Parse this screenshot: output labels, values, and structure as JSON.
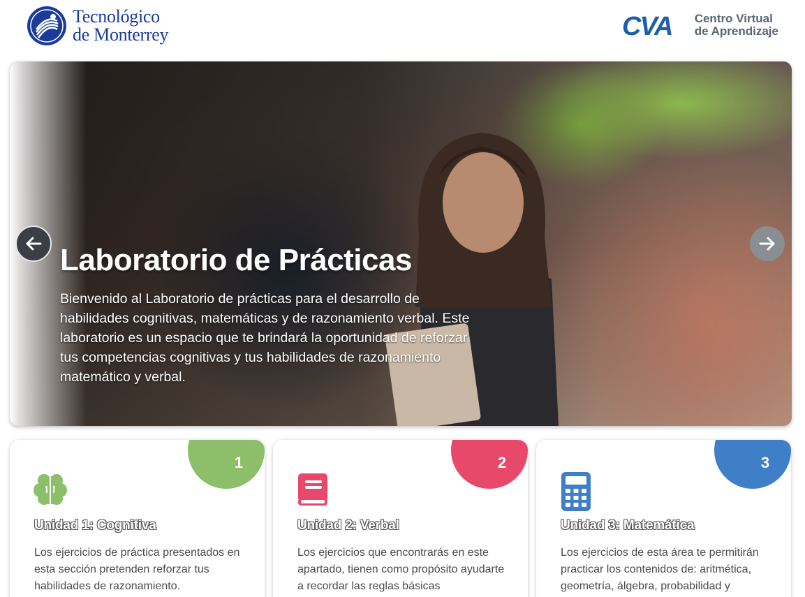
{
  "header": {
    "tec_logo": {
      "line1": "Tecnológico",
      "line2": "de Monterrey"
    },
    "cva_logo": {
      "mark": "CVA",
      "line1": "Centro Virtual",
      "line2": "de Aprendizaje"
    }
  },
  "hero": {
    "title": "Laboratorio de Prácticas",
    "description": "Bienvenido al Laboratorio de prácticas para el desarrollo de habilidades cognitivas, matemáticas y de razonamiento verbal. Este laboratorio es un espacio que te brindará la oportunidad de reforzar tus competencias cognitivas y tus habilidades de razonamiento matemático y verbal.",
    "prev_icon": "arrow-left-icon",
    "next_icon": "arrow-right-icon"
  },
  "cards": [
    {
      "number": "1",
      "title": "Unidad 1: Cognitiva",
      "text": "Los ejercicios de práctica presentados en esta sección pretenden reforzar tus habilidades de razonamiento.",
      "icon": "brain-icon",
      "color": "#8dbf6a"
    },
    {
      "number": "2",
      "title": "Unidad 2: Verbal",
      "text": "Los ejercicios que encontrarás en este apartado, tienen como propósito ayudarte a recordar las reglas básicas",
      "icon": "book-icon",
      "color": "#e8496b"
    },
    {
      "number": "3",
      "title": "Unidad 3: Matemática",
      "text": "Los ejercicios de esta área te permitirán practicar los contenidos de: aritmética, geometría, álgebra, probabilidad y",
      "icon": "calculator-icon",
      "color": "#3f7fc8"
    }
  ],
  "colors": {
    "tec_blue": "#1a3a9c",
    "cva_blue": "#1e5fa8",
    "cva_gray": "#5a6472"
  }
}
